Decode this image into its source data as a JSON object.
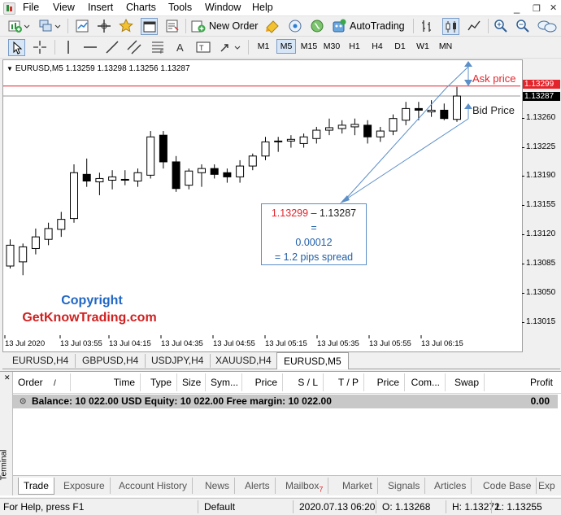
{
  "menu": {
    "items": [
      "File",
      "View",
      "Insert",
      "Charts",
      "Tools",
      "Window",
      "Help"
    ],
    "window_controls": [
      "_",
      "❐",
      "✕"
    ]
  },
  "toolbar": {
    "new_order_label": "New Order",
    "autotrading_label": "AutoTrading"
  },
  "timeframes": [
    "M1",
    "M5",
    "M15",
    "M30",
    "H1",
    "H4",
    "D1",
    "W1",
    "MN"
  ],
  "active_timeframe": "M5",
  "chart": {
    "header": "EURUSD,M5  1.13259 1.13298 1.13256 1.13287",
    "ask_badge": "1.13299",
    "bid_badge": "1.13287",
    "ask_color": "#e3242b",
    "y_labels": [
      "1.13260",
      "1.13225",
      "1.13190",
      "1.13155",
      "1.13120",
      "1.13085",
      "1.13050",
      "1.13015"
    ],
    "x_labels": [
      "13 Jul 2020",
      "13 Jul 03:55",
      "13 Jul 04:15",
      "13 Jul 04:35",
      "13 Jul 04:55",
      "13 Jul 05:15",
      "13 Jul 05:35",
      "13 Jul 05:55",
      "13 Jul 06:15"
    ],
    "ask_annotation": "Ask price",
    "bid_annotation": "Bid Price",
    "copyright_line1": "Copyright",
    "copyright_line2": "GetKnowTrading.com",
    "calc": {
      "ask": "1.13299",
      "dash": " – ",
      "bid": "1.13287",
      "equals": "=",
      "result": "0.00012",
      "spread": "= 1.2 pips spread"
    }
  },
  "chart_data": {
    "type": "candlestick",
    "symbol": "EURUSD",
    "timeframe": "M5",
    "ylim": [
      1.13,
      1.1333
    ],
    "bid_line": 1.13287,
    "ask_line": 1.13299,
    "candles": [
      {
        "o": 1.13083,
        "h": 1.13115,
        "l": 1.1308,
        "c": 1.13108
      },
      {
        "o": 1.13088,
        "h": 1.1311,
        "l": 1.13072,
        "c": 1.13106
      },
      {
        "o": 1.13104,
        "h": 1.13128,
        "l": 1.13097,
        "c": 1.13118
      },
      {
        "o": 1.13115,
        "h": 1.13135,
        "l": 1.13108,
        "c": 1.13128
      },
      {
        "o": 1.13127,
        "h": 1.13148,
        "l": 1.13118,
        "c": 1.13139
      },
      {
        "o": 1.1314,
        "h": 1.13205,
        "l": 1.13135,
        "c": 1.13195
      },
      {
        "o": 1.13193,
        "h": 1.13212,
        "l": 1.13178,
        "c": 1.13185
      },
      {
        "o": 1.13184,
        "h": 1.13195,
        "l": 1.13168,
        "c": 1.13188
      },
      {
        "o": 1.13186,
        "h": 1.13198,
        "l": 1.13175,
        "c": 1.1319
      },
      {
        "o": 1.13187,
        "h": 1.13198,
        "l": 1.1318,
        "c": 1.13186
      },
      {
        "o": 1.13185,
        "h": 1.132,
        "l": 1.13178,
        "c": 1.13195
      },
      {
        "o": 1.13192,
        "h": 1.13245,
        "l": 1.13188,
        "c": 1.13238
      },
      {
        "o": 1.1324,
        "h": 1.13245,
        "l": 1.132,
        "c": 1.13208
      },
      {
        "o": 1.13208,
        "h": 1.13215,
        "l": 1.13172,
        "c": 1.13176
      },
      {
        "o": 1.1318,
        "h": 1.132,
        "l": 1.13175,
        "c": 1.13197
      },
      {
        "o": 1.13195,
        "h": 1.13205,
        "l": 1.13178,
        "c": 1.132
      },
      {
        "o": 1.132,
        "h": 1.13205,
        "l": 1.13188,
        "c": 1.13193
      },
      {
        "o": 1.13195,
        "h": 1.132,
        "l": 1.13183,
        "c": 1.1319
      },
      {
        "o": 1.1319,
        "h": 1.1321,
        "l": 1.13183,
        "c": 1.13203
      },
      {
        "o": 1.13203,
        "h": 1.13218,
        "l": 1.13198,
        "c": 1.13215
      },
      {
        "o": 1.13215,
        "h": 1.13238,
        "l": 1.1321,
        "c": 1.13232
      },
      {
        "o": 1.13232,
        "h": 1.13238,
        "l": 1.1322,
        "c": 1.13233
      },
      {
        "o": 1.13233,
        "h": 1.1324,
        "l": 1.13225,
        "c": 1.13235
      },
      {
        "o": 1.1323,
        "h": 1.13242,
        "l": 1.13225,
        "c": 1.13238
      },
      {
        "o": 1.13236,
        "h": 1.1325,
        "l": 1.1323,
        "c": 1.13246
      },
      {
        "o": 1.13246,
        "h": 1.1326,
        "l": 1.1324,
        "c": 1.13249
      },
      {
        "o": 1.13248,
        "h": 1.13258,
        "l": 1.13242,
        "c": 1.13252
      },
      {
        "o": 1.1325,
        "h": 1.1326,
        "l": 1.1324,
        "c": 1.13253
      },
      {
        "o": 1.13252,
        "h": 1.13258,
        "l": 1.1323,
        "c": 1.13238
      },
      {
        "o": 1.13238,
        "h": 1.1325,
        "l": 1.13232,
        "c": 1.13245
      },
      {
        "o": 1.13245,
        "h": 1.13265,
        "l": 1.1324,
        "c": 1.1326
      },
      {
        "o": 1.13258,
        "h": 1.1328,
        "l": 1.13252,
        "c": 1.13272
      },
      {
        "o": 1.13272,
        "h": 1.1328,
        "l": 1.13258,
        "c": 1.1327
      },
      {
        "o": 1.13268,
        "h": 1.13282,
        "l": 1.13262,
        "c": 1.1327
      },
      {
        "o": 1.1327,
        "h": 1.13278,
        "l": 1.13258,
        "c": 1.1326
      },
      {
        "o": 1.13259,
        "h": 1.13298,
        "l": 1.13256,
        "c": 1.13287
      }
    ]
  },
  "symbol_tabs": [
    "EURUSD,H4",
    "GBPUSD,H4",
    "USDJPY,H4",
    "XAUUSD,H4",
    "EURUSD,M5"
  ],
  "active_symbol_tab": "EURUSD,M5",
  "terminal": {
    "side_label": "Terminal",
    "columns": [
      "Order",
      "Time",
      "Type",
      "Size",
      "Sym...",
      "Price",
      "S / L",
      "T / P",
      "Price",
      "Com...",
      "Swap",
      "Profit"
    ],
    "order_sort_glyph": "/",
    "balance_text": "Balance: 10 022.00 USD  Equity: 10 022.00  Free margin: 10 022.00",
    "balance_profit": "0.00",
    "tabs": [
      "Trade",
      "Exposure",
      "Account History",
      "News",
      "Alerts",
      "Mailbox",
      "Market",
      "Signals",
      "Articles",
      "Code Base",
      "Exp"
    ],
    "mailbox_count": "7",
    "active_tab": "Trade"
  },
  "status": {
    "help": "For Help, press F1",
    "profile": "Default",
    "datetime": "2020.07.13 06:20",
    "open": "O: 1.13268",
    "high": "H: 1.13272",
    "low": "L: 1.13255"
  }
}
